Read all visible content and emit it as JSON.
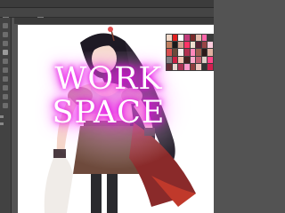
{
  "app": {
    "title": "",
    "watermark_line1": "WORK",
    "watermark_line2": "SPACE"
  },
  "colors": {
    "workspace_bg": "#535353",
    "canvas_bg": "#ffffff",
    "watermark_glow": "#e000e0"
  },
  "toolbar": {
    "tools": [
      "move-tool",
      "marquee-tool",
      "lasso-tool",
      "brush-tool",
      "eraser-tool",
      "fill-tool",
      "eyedropper-tool",
      "text-tool",
      "hand-tool",
      "zoom-tool"
    ]
  },
  "swatches": [
    "#f2d9c9",
    "#e02020",
    "#ffffff",
    "#c23b7a",
    "#7a2a2a",
    "#e8c0b0",
    "#ff66aa",
    "#3a3a3a",
    "#c08060",
    "#1a1a1a",
    "#d4a090",
    "#ff3366",
    "#f0e0d0",
    "#552233",
    "#994444",
    "#ffccdd",
    "#d85050",
    "#6a4a3a",
    "#f8f0f0",
    "#b03050",
    "#ff88bb",
    "#a06050",
    "#2a1a1a",
    "#e0b0a0",
    "#808080",
    "#cc2244",
    "#f4c4b4",
    "#442222",
    "#ffaacc",
    "#c06070",
    "#ddd0c8",
    "#ff4488",
    "#603030",
    "#e8d8d0",
    "#aa3355",
    "#ff99cc",
    "#904040",
    "#f0c8c0",
    "#333333",
    "#d02050"
  ]
}
